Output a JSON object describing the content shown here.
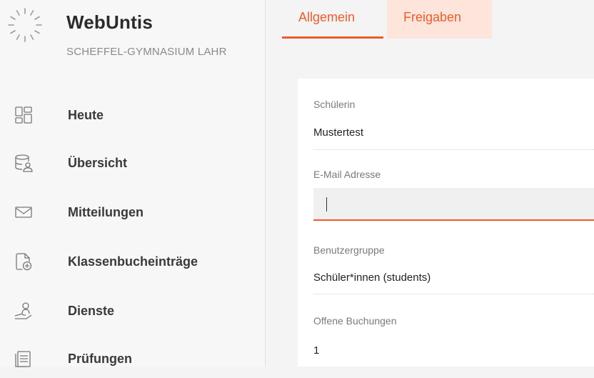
{
  "app": {
    "title": "WebUntis",
    "school": "SCHEFFEL-GYMNASIUM LAHR",
    "accent_color": "#f05a28"
  },
  "sidebar": {
    "items": [
      {
        "label": "Heute",
        "icon": "dashboard-icon"
      },
      {
        "label": "Übersicht",
        "icon": "database-user-icon"
      },
      {
        "label": "Mitteilungen",
        "icon": "envelope-icon"
      },
      {
        "label": "Klassenbucheinträge",
        "icon": "document-add-icon"
      },
      {
        "label": "Dienste",
        "icon": "user-service-icon"
      },
      {
        "label": "Prüfungen",
        "icon": "exam-list-icon"
      }
    ]
  },
  "tabs": [
    {
      "label": "Allgemein",
      "active": true
    },
    {
      "label": "Freigaben",
      "active": false
    }
  ],
  "form": {
    "student": {
      "label": "Schülerin",
      "value": "Mustertest"
    },
    "email": {
      "label": "E-Mail Adresse",
      "value": ""
    },
    "user_group": {
      "label": "Benutzergruppe",
      "value": "Schüler*innen (students)"
    },
    "open_bookings": {
      "label": "Offene Buchungen",
      "value": "1"
    }
  }
}
